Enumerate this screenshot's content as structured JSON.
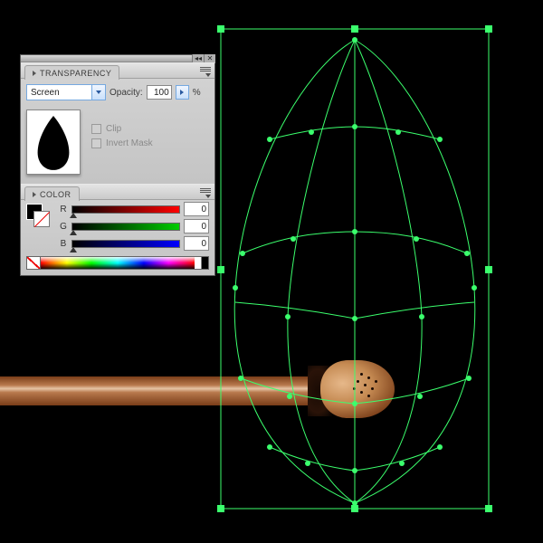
{
  "canvas": {
    "selection_color": "#3bff6d"
  },
  "panels": {
    "transparency": {
      "tab_label": "TRANSPARENCY",
      "blend_mode": "Screen",
      "opacity_label": "Opacity:",
      "opacity_value": "100",
      "opacity_unit": "%",
      "clip_label": "Clip",
      "invert_mask_label": "Invert Mask"
    },
    "color": {
      "tab_label": "COLOR",
      "channels": {
        "r": {
          "label": "R",
          "value": "0"
        },
        "g": {
          "label": "G",
          "value": "0"
        },
        "b": {
          "label": "B",
          "value": "0"
        }
      },
      "fill": "#000000",
      "stroke": "none"
    }
  }
}
